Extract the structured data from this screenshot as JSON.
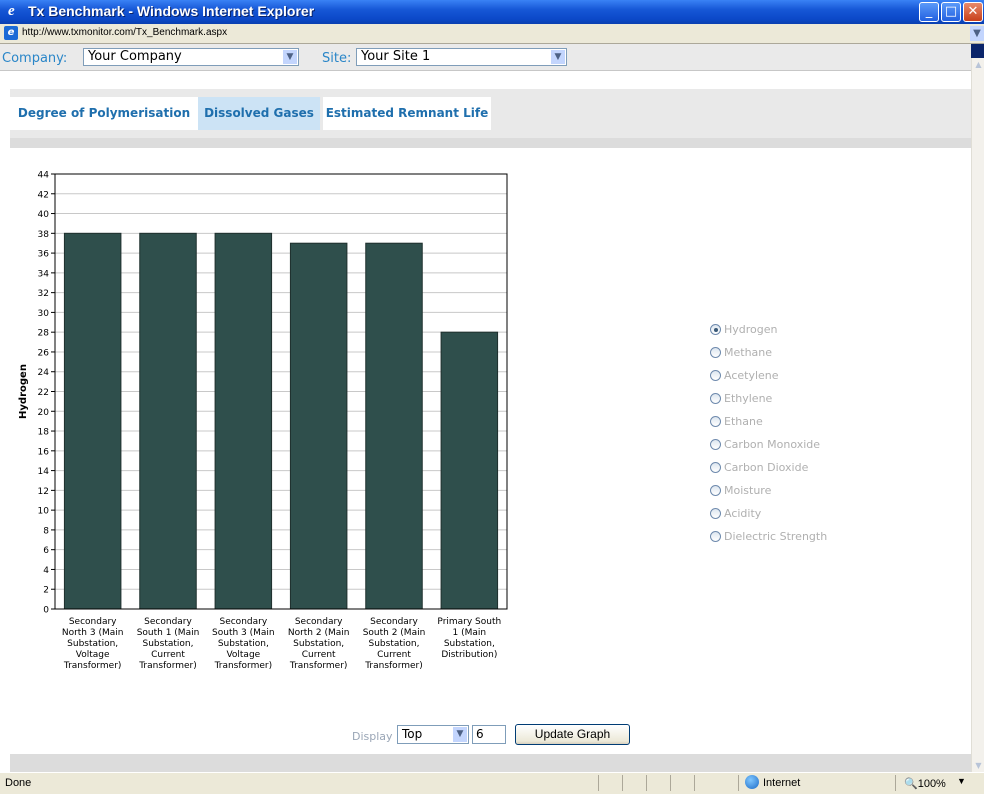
{
  "window": {
    "title": "Tx Benchmark - Windows Internet Explorer",
    "url": "http://www.txmonitor.com/Tx_Benchmark.aspx"
  },
  "selectors": {
    "company_label": "Company:",
    "company_value": "Your Company",
    "site_label": "Site:",
    "site_value": "Your Site 1"
  },
  "tabs": [
    {
      "label": "Degree of Polymerisation",
      "active": false
    },
    {
      "label": "Dissolved Gases",
      "active": true
    },
    {
      "label": "Estimated Remnant Life",
      "active": false
    }
  ],
  "gases": {
    "selected": "Hydrogen",
    "options": [
      "Hydrogen",
      "Methane",
      "Acetylene",
      "Ethylene",
      "Ethane",
      "Carbon Monoxide",
      "Carbon Dioxide",
      "Moisture",
      "Acidity",
      "Dielectric Strength"
    ]
  },
  "display": {
    "label": "Display",
    "mode": "Top",
    "count": "6",
    "button": "Update Graph"
  },
  "status": {
    "text": "Done",
    "zone": "Internet",
    "zoom": "100%"
  },
  "chart_data": {
    "type": "bar",
    "ylabel": "Hydrogen",
    "ylim": [
      0,
      44
    ],
    "yticks": [
      0,
      2,
      4,
      6,
      8,
      10,
      12,
      14,
      16,
      18,
      20,
      22,
      24,
      26,
      28,
      30,
      32,
      34,
      36,
      38,
      40,
      42,
      44
    ],
    "bar_color": "#2f4f4c",
    "categories": [
      [
        "Secondary",
        "North 3 (Main",
        "Substation,",
        "Voltage",
        "Transformer)"
      ],
      [
        "Secondary",
        "South 1 (Main",
        "Substation,",
        "Current",
        "Transformer)"
      ],
      [
        "Secondary",
        "South 3 (Main",
        "Substation,",
        "Voltage",
        "Transformer)"
      ],
      [
        "Secondary",
        "North 2 (Main",
        "Substation,",
        "Current",
        "Transformer)"
      ],
      [
        "Secondary",
        "South 2 (Main",
        "Substation,",
        "Current",
        "Transformer)"
      ],
      [
        "Primary South",
        "1 (Main",
        "Substation,",
        "Distribution)"
      ]
    ],
    "values": [
      38,
      38,
      38,
      37,
      37,
      28
    ],
    "grid": true
  }
}
